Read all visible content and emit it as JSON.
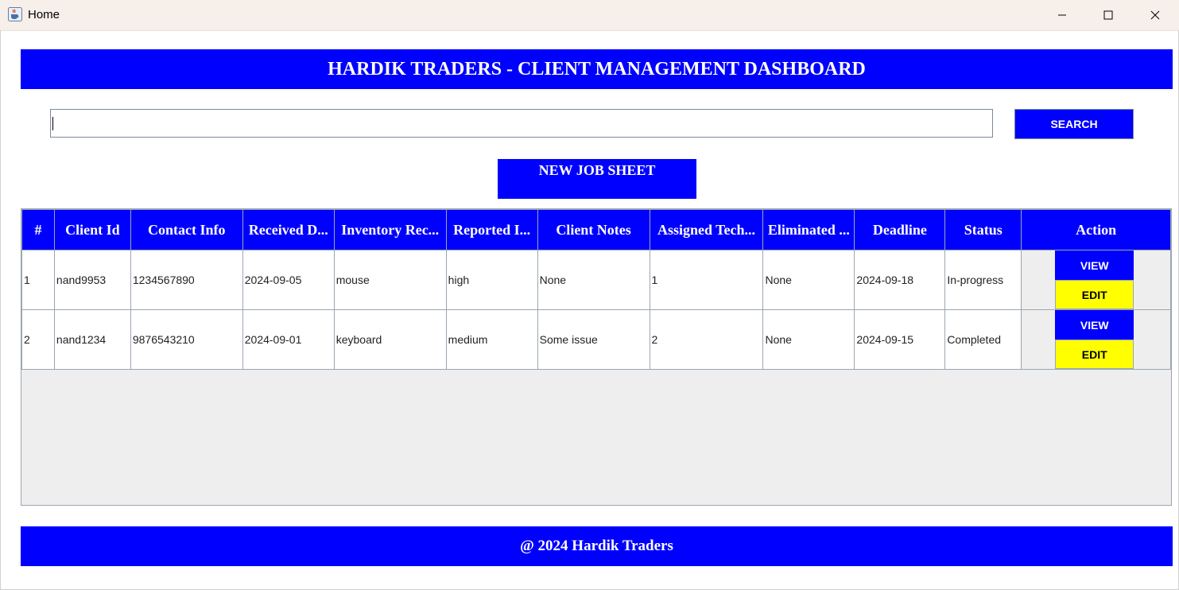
{
  "window": {
    "title": "Home"
  },
  "header": {
    "title": "HARDIK TRADERS - CLIENT MANAGEMENT DASHBOARD"
  },
  "search": {
    "value": "",
    "placeholder": "",
    "button_label": "SEARCH"
  },
  "new_job": {
    "label": "NEW JOB SHEET"
  },
  "table": {
    "columns": [
      "#",
      "Client Id",
      "Contact Info",
      "Received D...",
      "Inventory Rec...",
      "Reported I...",
      "Client Notes",
      "Assigned Tech...",
      "Eliminated ...",
      "Deadline",
      "Status",
      "Action"
    ],
    "rows": [
      [
        "1",
        "nand9953",
        "1234567890",
        "2024-09-05",
        "mouse",
        "high",
        "None",
        "1",
        "None",
        "2024-09-18",
        "In-progress"
      ],
      [
        "2",
        "nand1234",
        "9876543210",
        "2024-09-01",
        "keyboard",
        "medium",
        "Some issue",
        "2",
        "None",
        "2024-09-15",
        "Completed"
      ]
    ],
    "action_labels": {
      "view": "VIEW",
      "edit": "EDIT"
    }
  },
  "footer": {
    "text": "@ 2024 Hardik Traders"
  },
  "colors": {
    "primary": "#0000ff",
    "edit": "#ffff00",
    "titlebar": "#f7efea",
    "table_bg": "#eeeeee"
  },
  "icons": {
    "app": "java-cup-icon",
    "minimize": "minimize-icon",
    "maximize": "maximize-icon",
    "close": "close-icon"
  }
}
